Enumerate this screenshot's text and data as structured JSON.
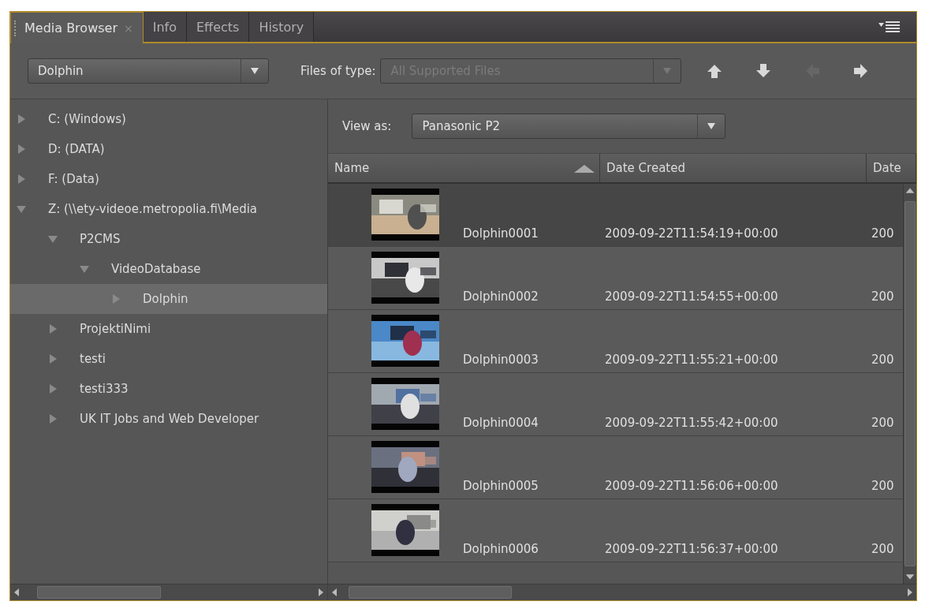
{
  "tabs": [
    {
      "label": "Media Browser",
      "selected": true,
      "close": "×"
    },
    {
      "label": "Info",
      "selected": false
    },
    {
      "label": "Effects",
      "selected": false
    },
    {
      "label": "History",
      "selected": false
    }
  ],
  "toolbar": {
    "location": {
      "value": "Dolphin"
    },
    "files_of_type": {
      "label": "Files of type:",
      "value": "All Supported Files",
      "disabled": true
    },
    "nav_buttons": [
      {
        "kind": "up",
        "disabled": false
      },
      {
        "kind": "down",
        "disabled": false
      },
      {
        "kind": "back",
        "disabled": true
      },
      {
        "kind": "forward",
        "disabled": false
      }
    ]
  },
  "tree": [
    {
      "label": "C: (Windows)",
      "expanded": false,
      "selected": false
    },
    {
      "label": "D: (DATA)",
      "expanded": false,
      "selected": false
    },
    {
      "label": "F: (Data)",
      "expanded": false,
      "selected": false
    },
    {
      "label": "Z: (\\\\ety-videoe.metropolia.fi\\Media",
      "expanded": true,
      "selected": false,
      "children": [
        {
          "label": "P2CMS",
          "expanded": true,
          "selected": false,
          "children": [
            {
              "label": "VideoDatabase",
              "expanded": true,
              "selected": false,
              "children": [
                {
                  "label": "Dolphin",
                  "expanded": false,
                  "selected": true
                }
              ]
            }
          ]
        },
        {
          "label": "ProjektiNimi",
          "expanded": false,
          "selected": false
        },
        {
          "label": "testi",
          "expanded": false,
          "selected": false
        },
        {
          "label": "testi333",
          "expanded": false,
          "selected": false
        },
        {
          "label": "UK IT Jobs and Web Developer",
          "expanded": false,
          "selected": false
        }
      ]
    }
  ],
  "view_as": {
    "label": "View as:",
    "value": "Panasonic P2"
  },
  "table": {
    "columns": [
      {
        "label": "Name",
        "sorted": true
      },
      {
        "label": "Date Created",
        "sorted": false
      },
      {
        "label": "Date ",
        "sorted": false
      }
    ],
    "rows": [
      {
        "name": "Dolphin0001",
        "date_created": "2009-09-22T11:54:19+00:00",
        "column_3": "200",
        "selected": true
      },
      {
        "name": "Dolphin0002",
        "date_created": "2009-09-22T11:54:55+00:00",
        "column_3": "200",
        "selected": false
      },
      {
        "name": "Dolphin0003",
        "date_created": "2009-09-22T11:55:21+00:00",
        "column_3": "200",
        "selected": false
      },
      {
        "name": "Dolphin0004",
        "date_created": "2009-09-22T11:55:42+00:00",
        "column_3": "200",
        "selected": false
      },
      {
        "name": "Dolphin0005",
        "date_created": "2009-09-22T11:56:06+00:00",
        "column_3": "200",
        "selected": false
      },
      {
        "name": "Dolphin0006",
        "date_created": "2009-09-22T11:56:37+00:00",
        "column_3": "200",
        "selected": false
      }
    ]
  }
}
